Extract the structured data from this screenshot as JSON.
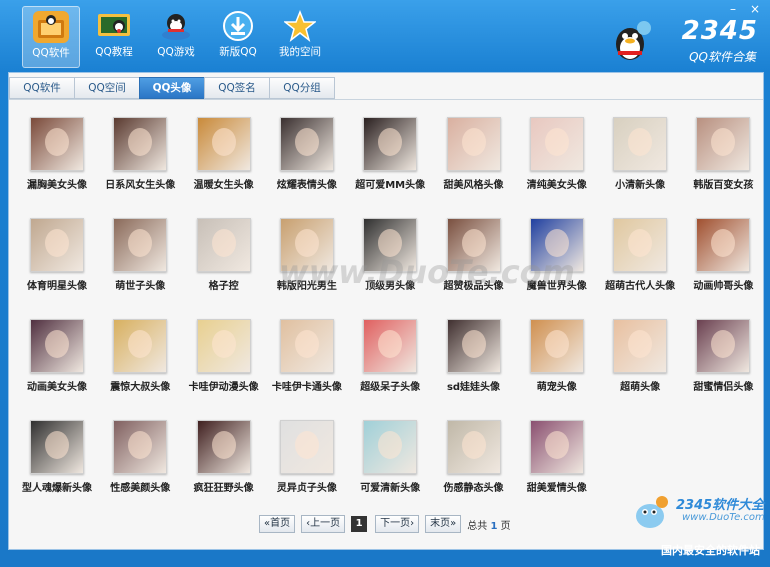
{
  "toolbar": [
    {
      "label": "QQ软件",
      "icon": "qq-software-icon",
      "active": true
    },
    {
      "label": "QQ教程",
      "icon": "qq-tutorial-icon",
      "active": false
    },
    {
      "label": "QQ游戏",
      "icon": "qq-game-icon",
      "active": false
    },
    {
      "label": "新版QQ",
      "icon": "download-icon",
      "active": false
    },
    {
      "label": "我的空间",
      "icon": "star-icon",
      "active": false
    }
  ],
  "window_controls": {
    "minimize": "–",
    "close": "×"
  },
  "brand": {
    "number": "2345",
    "subtitle": "QQ软件合集"
  },
  "tabs": [
    {
      "label": "QQ软件",
      "active": false
    },
    {
      "label": "QQ空间",
      "active": false
    },
    {
      "label": "QQ头像",
      "active": true
    },
    {
      "label": "QQ签名",
      "active": false
    },
    {
      "label": "QQ分组",
      "active": false
    }
  ],
  "avatars": [
    {
      "caption": "漏胸美女头像",
      "color": "#7a4a3a"
    },
    {
      "caption": "日系风女生头像",
      "color": "#5a3a30"
    },
    {
      "caption": "温暖女生头像",
      "color": "#c98a3a"
    },
    {
      "caption": "炫耀表情头像",
      "color": "#3a3030"
    },
    {
      "caption": "超可爱MM头像",
      "color": "#2a2020"
    },
    {
      "caption": "甜美风格头像",
      "color": "#d9b0a0"
    },
    {
      "caption": "清纯美女头像",
      "color": "#e8c8c0"
    },
    {
      "caption": "小清新头像",
      "color": "#d8d0c0"
    },
    {
      "caption": "韩版百变女孩",
      "color": "#b89080"
    },
    {
      "caption": "体育明星头像",
      "color": "#c0a890"
    },
    {
      "caption": "萌世子头像",
      "color": "#8a6a5a"
    },
    {
      "caption": "格子控",
      "color": "#c8c0b8"
    },
    {
      "caption": "韩版阳光男生",
      "color": "#c8a070"
    },
    {
      "caption": "顶级男头像",
      "color": "#303030"
    },
    {
      "caption": "超赞极品头像",
      "color": "#7a5040"
    },
    {
      "caption": "魔兽世界头像",
      "color": "#2040a0"
    },
    {
      "caption": "超萌古代人头像",
      "color": "#e0c8a0"
    },
    {
      "caption": "动画帅哥头像",
      "color": "#a05030"
    },
    {
      "caption": "动画美女头像",
      "color": "#503040"
    },
    {
      "caption": "震惊大叔头像",
      "color": "#d8b060"
    },
    {
      "caption": "卡哇伊动漫头像",
      "color": "#e8d090"
    },
    {
      "caption": "卡哇伊卡通头像",
      "color": "#e0c0a0"
    },
    {
      "caption": "超级呆子头像",
      "color": "#e06060"
    },
    {
      "caption": "sd娃娃头像",
      "color": "#403030"
    },
    {
      "caption": "萌宠头像",
      "color": "#d09050"
    },
    {
      "caption": "超萌头像",
      "color": "#e8c0a0"
    },
    {
      "caption": "甜蜜情侣头像",
      "color": "#6a4050"
    },
    {
      "caption": "型人魂爆新头像",
      "color": "#303030"
    },
    {
      "caption": "性感美颜头像",
      "color": "#806060"
    },
    {
      "caption": "疯狂狂野头像",
      "color": "#402020"
    },
    {
      "caption": "灵异贞子头像",
      "color": "#e0e0e0"
    },
    {
      "caption": "可爱清新头像",
      "color": "#a0d0d8"
    },
    {
      "caption": "伤感静态头像",
      "color": "#c0b8a8"
    },
    {
      "caption": "甜美爱情头像",
      "color": "#8a5070"
    }
  ],
  "pager": {
    "first": "«首页",
    "prev": "‹上一页",
    "current": "1",
    "next": "下一页›",
    "last": "末页»",
    "total_prefix": "总共",
    "total_pages": "1",
    "total_suffix": "页"
  },
  "watermark": "www.DuoTe.com",
  "footer": {
    "logo_title": "2345软件大全",
    "logo_url": "www.DuoTe.com",
    "slogan": "国内最安全的软件站"
  }
}
